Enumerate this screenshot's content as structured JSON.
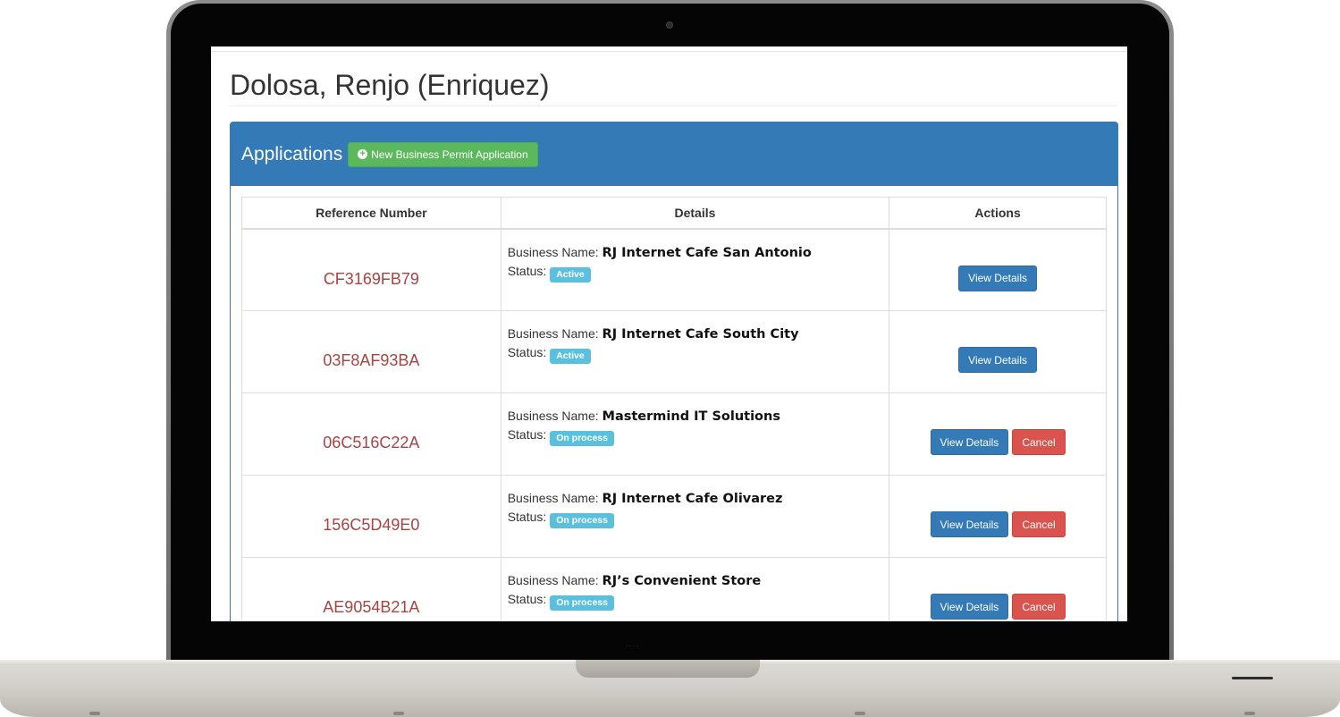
{
  "page": {
    "title": "Dolosa, Renjo (Enriquez)"
  },
  "panel": {
    "title": "Applications",
    "new_button_label": "New Business Permit Application"
  },
  "table": {
    "headers": [
      "Reference Number",
      "Details",
      "Actions"
    ],
    "business_name_label": "Business Name:",
    "status_label": "Status:",
    "rows": [
      {
        "reference": "CF3169FB79",
        "business_name": "RJ Internet Cafe San Antonio",
        "status": "Active",
        "status_color": "#5bc0de",
        "actions": [
          "View Details"
        ]
      },
      {
        "reference": "03F8AF93BA",
        "business_name": "RJ Internet Cafe South City",
        "status": "Active",
        "status_color": "#5bc0de",
        "actions": [
          "View Details"
        ]
      },
      {
        "reference": "06C516C22A",
        "business_name": "Mastermind IT Solutions",
        "status": "On process",
        "status_color": "#5bc0de",
        "actions": [
          "View Details",
          "Cancel"
        ]
      },
      {
        "reference": "156C5D49E0",
        "business_name": "RJ Internet Cafe Olivarez",
        "status": "On process",
        "status_color": "#5bc0de",
        "actions": [
          "View Details",
          "Cancel"
        ]
      },
      {
        "reference": "AE9054B21A",
        "business_name": "RJ’s Convenient Store",
        "status": "On process",
        "status_color": "#5bc0de",
        "actions": [
          "View Details",
          "Cancel"
        ]
      }
    ]
  },
  "colors": {
    "primary": "#337ab7",
    "success": "#5cb85c",
    "danger": "#d9534f",
    "info": "#5bc0de",
    "reference_text": "#a94442"
  }
}
